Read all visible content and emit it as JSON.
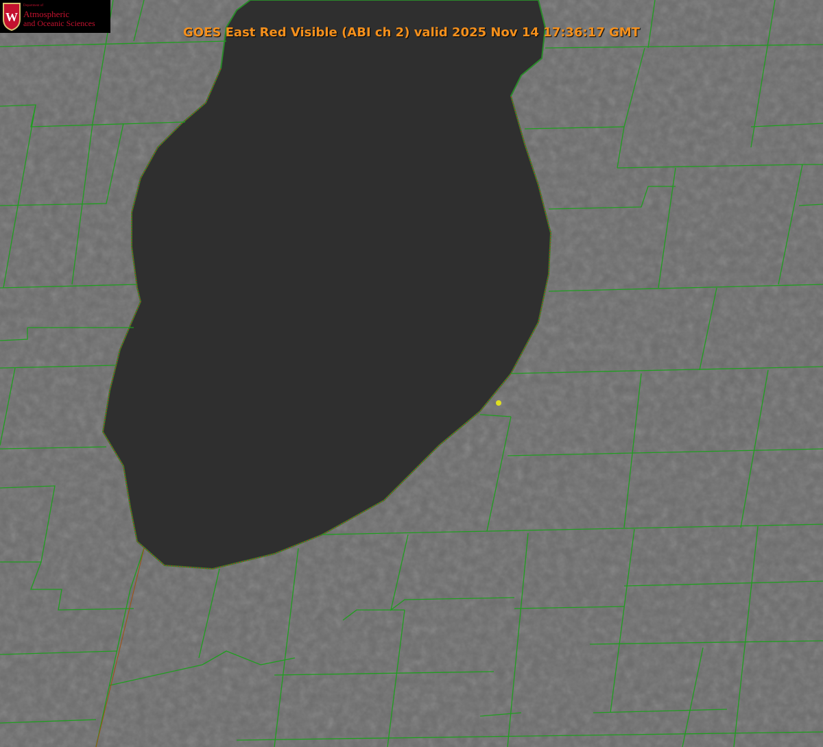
{
  "title": "GOES East Red Visible (ABI ch 2) valid 2025 Nov 14 17:36:17 GMT",
  "logo": {
    "line1": "Department of",
    "line2": "Atmospheric",
    "line3": "and Oceanic Sciences",
    "crest_letter": "W"
  },
  "colors": {
    "land": "#6a6a6a",
    "lake": "#2e2e2e",
    "county_lines": "#1f9e1f",
    "shoreline": "#d02020",
    "title": "#f5901c",
    "marker": "#e0e020"
  }
}
